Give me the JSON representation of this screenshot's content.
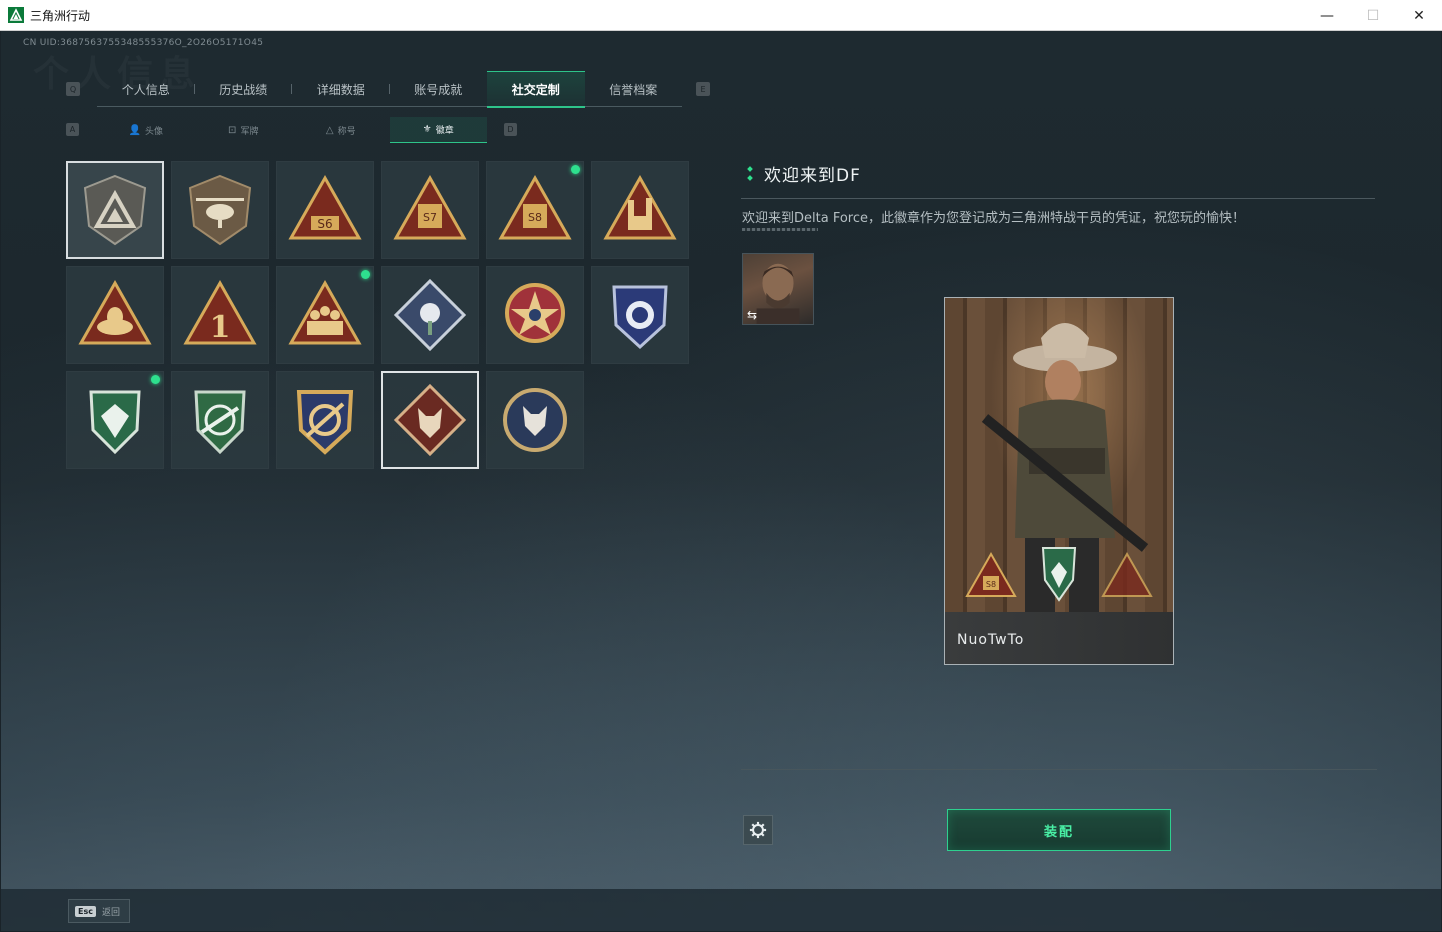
{
  "window": {
    "title": "三角洲行动",
    "minimize": "—",
    "maximize": "☐",
    "close": "✕"
  },
  "uid": "CN UID:3687563755348555376O_2O26O5171O45",
  "background_title": "个人信息",
  "main_tabs": {
    "left_key": "Q",
    "right_key": "E",
    "items": [
      {
        "label": "个人信息"
      },
      {
        "label": "历史战绩"
      },
      {
        "label": "详细数据"
      },
      {
        "label": "账号成就"
      },
      {
        "label": "社交定制",
        "active": true
      },
      {
        "label": "信誉档案"
      }
    ]
  },
  "sub_tabs": {
    "left_key": "A",
    "right_key": "D",
    "items": [
      {
        "label": "头像",
        "icon": "person-icon"
      },
      {
        "label": "军牌",
        "icon": "dogtag-icon"
      },
      {
        "label": "称号",
        "icon": "title-icon"
      },
      {
        "label": "徽章",
        "icon": "badge-icon",
        "active": true
      }
    ]
  },
  "badges": [
    {
      "id": "df-welcome",
      "selected": true
    },
    {
      "id": "helicopter"
    },
    {
      "id": "s6"
    },
    {
      "id": "s7"
    },
    {
      "id": "s8",
      "new": true
    },
    {
      "id": "rock-hand"
    },
    {
      "id": "golden-lotus"
    },
    {
      "id": "number-one"
    },
    {
      "id": "squad",
      "new": true
    },
    {
      "id": "rose-diamond"
    },
    {
      "id": "star-compass"
    },
    {
      "id": "blue-shield"
    },
    {
      "id": "green-gem",
      "new": true
    },
    {
      "id": "green-rifle"
    },
    {
      "id": "gold-crosshair"
    },
    {
      "id": "wolf-diamond",
      "equipped": true
    },
    {
      "id": "wolf-circle"
    }
  ],
  "detail": {
    "title": "欢迎来到DF",
    "description": "欢迎来到Delta Force，此徽章作为您登记成为三角洲特战干员的凭证，祝您玩的愉快！",
    "swap_icon": "⇆"
  },
  "card": {
    "player_name": "NuoTwTo",
    "badge_label": "S8"
  },
  "equip_button": "装配",
  "footer": {
    "esc_key": "Esc",
    "esc_label": "返回"
  },
  "colors": {
    "accent": "#2ee08e",
    "background": "#1c272d"
  }
}
